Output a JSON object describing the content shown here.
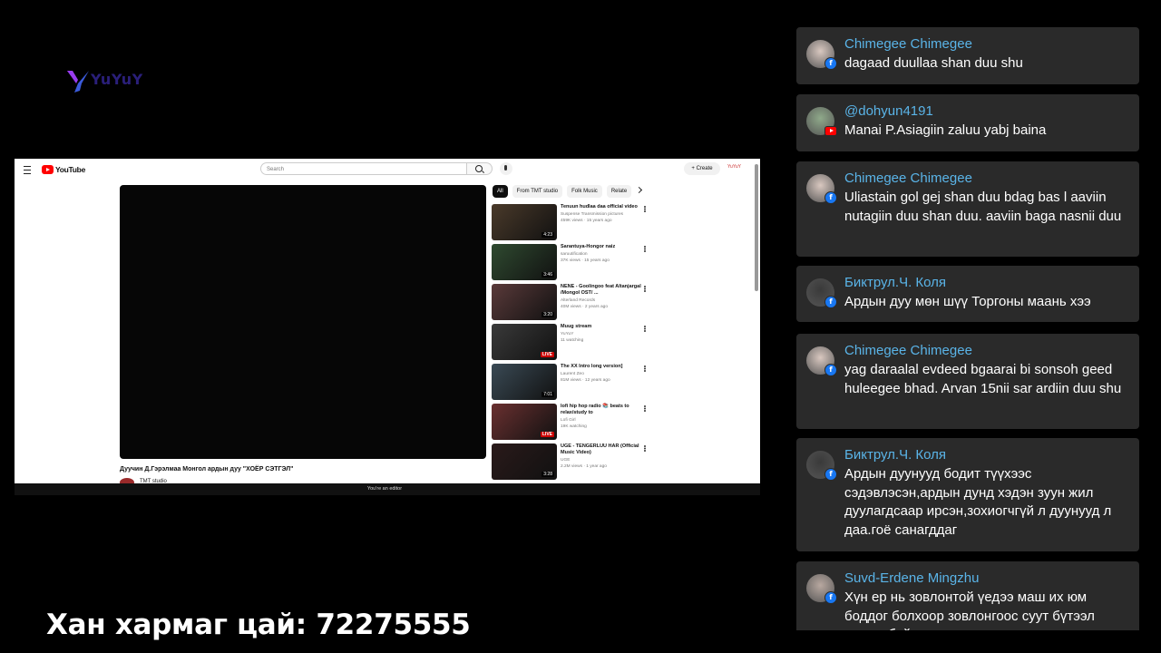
{
  "logo": {
    "text": "YuYuY"
  },
  "browser": {
    "hamburger_icon": "menu-icon",
    "youtube_wordmark": "YouTube",
    "search_placeholder": "Search",
    "create_label": "Create",
    "account_label": "YuYuY",
    "video_title": "Дуучин Д.Гэрэлмаа Монгол ардын дуу \"ХОЁР СЭТГЭЛ\"",
    "channel_name": "TMT studio",
    "editor_notice": "You're an editor",
    "chips": [
      {
        "label": "All",
        "active": true
      },
      {
        "label": "From TMT studio",
        "active": false
      },
      {
        "label": "Folk Music",
        "active": false
      },
      {
        "label": "Relate",
        "active": false
      }
    ],
    "recommendations": [
      {
        "title": "Tenuun hudlaa daa official video",
        "channel": "Suspense Transmission pictures",
        "meta": "459K views · 15 years ago",
        "badge": "4:23",
        "live": false,
        "thumb_color": "#4a3a2a"
      },
      {
        "title": "Sarantuya-Hongor naiz",
        "channel": "saruutification",
        "meta": "37K views · 15 years ago",
        "badge": "3:46",
        "live": false,
        "thumb_color": "#2f4a30"
      },
      {
        "title": "NENE - Goolingoo feat Altanjargal /Mongol OST/ ...",
        "channel": "Alterland Records",
        "meta": "40M views · 2 years ago",
        "badge": "3:20",
        "live": false,
        "thumb_color": "#5a3a3a"
      },
      {
        "title": "Muug stream",
        "channel": "YuYuY",
        "meta": "11 watching",
        "badge": "LIVE",
        "live": true,
        "thumb_color": "#3a3a3a"
      },
      {
        "title": "The XX   Intro long version]",
        "channel": "Laurent Zeo",
        "meta": "81M views · 12 years ago",
        "badge": "7:01",
        "live": false,
        "thumb_color": "#3a4a55"
      },
      {
        "title": "lofi hip hop radio 📚 beats to relax/study to",
        "channel": "Lofi Girl",
        "meta": "19K watching",
        "badge": "LIVE",
        "live": true,
        "thumb_color": "#6a3030"
      },
      {
        "title": "UGE - TENGERLUU HAR (Official Music Video)",
        "channel": "UGE",
        "meta": "2.2M views · 1 year ago",
        "badge": "3:28",
        "live": false,
        "thumb_color": "#2a1a1a"
      }
    ]
  },
  "caption": "Хан хармаг цай: 72275555",
  "chat": [
    {
      "author": "Chimegee Chimegee",
      "text": "dagaad duullaa shan duu shu",
      "source": "facebook",
      "avatar_color": "#d9c8c0"
    },
    {
      "author": "@dohyun4191",
      "text": "Manai P.Asiagiin zaluu yabj baina",
      "source": "youtube",
      "avatar_color": "#8fa98a"
    },
    {
      "author": "Chimegee Chimegee",
      "text": "Uliastain gol gej shan duu bdag bas l aaviin nutagiin duu shan duu. aaviin baga nasnii duu",
      "source": "facebook",
      "avatar_color": "#d9c8c0"
    },
    {
      "author": "Биктрул.Ч. Коля",
      "text": "Ардын дуу мөн шүү Торгоны маань хээ",
      "source": "facebook",
      "avatar_color": "#3a3a3a"
    },
    {
      "author": "Chimegee Chimegee",
      "text": "yag daraalal evdeed bgaarai bi sonsoh geed huleegee bhad. Arvan 15nii sar ardiin duu shu",
      "source": "facebook",
      "avatar_color": "#d9c8c0"
    },
    {
      "author": "Биктрул.Ч. Коля",
      "text": "Ардын дуунууд бодит түүхээс сэдэвлэсэн,ардын дунд хэдэн зуун жил дуулагдсаар ирсэн,зохиогчгүй л дуунууд л даа.гоё санагддаг",
      "source": "facebook",
      "avatar_color": "#3a3a3a"
    },
    {
      "author": "Suvd-Erdene Mingzhu",
      "text": "Хүн ер нь зовлонтой үедээ маш их юм боддог болхоор зовлонгоос суут бүтээл гардаг байх",
      "source": "facebook",
      "avatar_color": "#b8a8a0"
    }
  ]
}
